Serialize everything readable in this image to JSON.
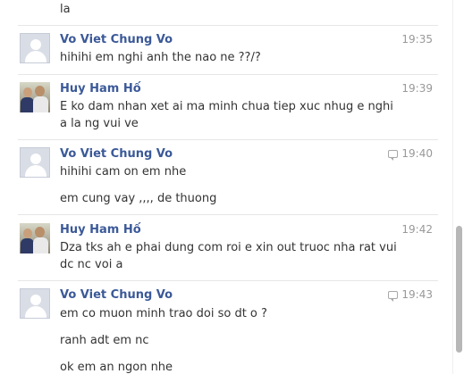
{
  "messages": [
    {
      "type": "line",
      "text": "la"
    },
    {
      "type": "header",
      "sender": "Vo Viet Chung Vo",
      "time": "19:35",
      "avatar": "default-avatar",
      "reply_icon": false
    },
    {
      "type": "line",
      "text": "hihihi em nghi anh the nao ne ??/?"
    },
    {
      "type": "header",
      "sender": "Huy Ham Hố",
      "time": "19:39",
      "avatar": "photo-avatar",
      "reply_icon": false
    },
    {
      "type": "line",
      "text": "E ko dam nhan xet ai ma minh chua tiep xuc nhug e nghi"
    },
    {
      "type": "line",
      "text": "a la ng vui ve"
    },
    {
      "type": "header",
      "sender": "Vo Viet Chung Vo",
      "time": "19:40",
      "avatar": "default-avatar",
      "reply_icon": true
    },
    {
      "type": "line",
      "text": "hihihi cam on em nhe"
    },
    {
      "type": "line",
      "text": "em cung vay ,,,, de thuong"
    },
    {
      "type": "header",
      "sender": "Huy Ham Hố",
      "time": "19:42",
      "avatar": "photo-avatar",
      "reply_icon": false
    },
    {
      "type": "line",
      "text": "Dza tks ah e phai dung com roi e xin out truoc nha rat vui"
    },
    {
      "type": "line",
      "text": "dc nc voi a"
    },
    {
      "type": "header",
      "sender": "Vo Viet Chung Vo",
      "time": "19:43",
      "avatar": "default-avatar",
      "reply_icon": true
    },
    {
      "type": "line",
      "text": "em co muon minh trao doi so dt o ?"
    },
    {
      "type": "line",
      "text": "ranh adt em nc"
    },
    {
      "type": "line",
      "text": "ok em an ngon nhe"
    }
  ]
}
